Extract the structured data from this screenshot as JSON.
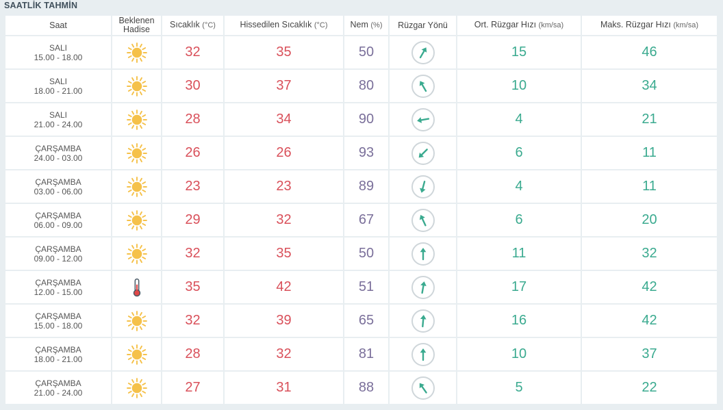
{
  "title": "SAATLİK TAHMİN",
  "headers": {
    "time": "Saat",
    "event_line1": "Beklenen",
    "event_line2": "Hadise",
    "temp": "Sıcaklık",
    "temp_unit": "(°C)",
    "feels": "Hissedilen Sıcaklık",
    "feels_unit": "(°C)",
    "humidity": "Nem",
    "humidity_unit": "(%)",
    "wind_dir": "Rüzgar Yönü",
    "wind_avg": "Ort. Rüzgar Hızı",
    "wind_avg_unit": "(km/sa)",
    "wind_max": "Maks. Rüzgar Hızı",
    "wind_max_unit": "(km/sa)"
  },
  "colors": {
    "temp": "#d9505a",
    "humidity": "#7a6f9a",
    "wind": "#3aaa8f",
    "sun": "#f5c14a"
  },
  "rows": [
    {
      "day": "SALI",
      "range": "15.00 - 18.00",
      "icon": "sun-icon",
      "temp": "32",
      "feels": "35",
      "humidity": "50",
      "wind_dir_deg": 30,
      "wind_avg": "15",
      "wind_max": "46"
    },
    {
      "day": "SALI",
      "range": "18.00 - 21.00",
      "icon": "sun-icon",
      "temp": "30",
      "feels": "37",
      "humidity": "80",
      "wind_dir_deg": -30,
      "wind_avg": "10",
      "wind_max": "34"
    },
    {
      "day": "SALI",
      "range": "21.00 - 24.00",
      "icon": "sun-icon",
      "temp": "28",
      "feels": "34",
      "humidity": "90",
      "wind_dir_deg": -100,
      "wind_avg": "4",
      "wind_max": "21"
    },
    {
      "day": "ÇARŞAMBA",
      "range": "24.00 - 03.00",
      "icon": "sun-icon",
      "temp": "26",
      "feels": "26",
      "humidity": "93",
      "wind_dir_deg": -135,
      "wind_avg": "6",
      "wind_max": "11"
    },
    {
      "day": "ÇARŞAMBA",
      "range": "03.00 - 06.00",
      "icon": "sun-icon",
      "temp": "23",
      "feels": "23",
      "humidity": "89",
      "wind_dir_deg": -165,
      "wind_avg": "4",
      "wind_max": "11"
    },
    {
      "day": "ÇARŞAMBA",
      "range": "06.00 - 09.00",
      "icon": "sun-icon",
      "temp": "29",
      "feels": "32",
      "humidity": "67",
      "wind_dir_deg": -25,
      "wind_avg": "6",
      "wind_max": "20"
    },
    {
      "day": "ÇARŞAMBA",
      "range": "09.00 - 12.00",
      "icon": "sun-icon",
      "temp": "32",
      "feels": "35",
      "humidity": "50",
      "wind_dir_deg": 0,
      "wind_avg": "11",
      "wind_max": "32"
    },
    {
      "day": "ÇARŞAMBA",
      "range": "12.00 - 15.00",
      "icon": "thermometer-icon",
      "temp": "35",
      "feels": "42",
      "humidity": "51",
      "wind_dir_deg": 10,
      "wind_avg": "17",
      "wind_max": "42"
    },
    {
      "day": "ÇARŞAMBA",
      "range": "15.00 - 18.00",
      "icon": "sun-icon",
      "temp": "32",
      "feels": "39",
      "humidity": "65",
      "wind_dir_deg": 5,
      "wind_avg": "16",
      "wind_max": "42"
    },
    {
      "day": "ÇARŞAMBA",
      "range": "18.00 - 21.00",
      "icon": "sun-icon",
      "temp": "28",
      "feels": "32",
      "humidity": "81",
      "wind_dir_deg": 0,
      "wind_avg": "10",
      "wind_max": "37"
    },
    {
      "day": "ÇARŞAMBA",
      "range": "21.00 - 24.00",
      "icon": "sun-icon",
      "temp": "27",
      "feels": "31",
      "humidity": "88",
      "wind_dir_deg": -35,
      "wind_avg": "5",
      "wind_max": "22"
    }
  ]
}
